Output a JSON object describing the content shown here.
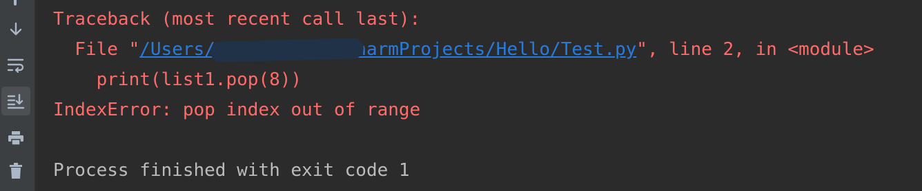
{
  "toolbar": {
    "buttons": [
      {
        "icon": "arrow-down-icon",
        "active": false
      },
      {
        "icon": "soft-wrap-icon",
        "active": false
      },
      {
        "icon": "scroll-to-end-icon",
        "active": true
      },
      {
        "icon": "print-icon",
        "active": false
      },
      {
        "icon": "trash-icon",
        "active": false
      }
    ]
  },
  "console": {
    "traceback_header": "Traceback (most recent call last):",
    "file_prefix": "  File \"",
    "file_path": "/Users/         /PycharmProjects/Hello/Test.py",
    "file_suffix": "\", line 2, in <module>",
    "code_line": "    print(list1.pop(8))",
    "error_line": "IndexError: pop index out of range",
    "exit_line": "Process finished with exit code 1"
  },
  "colors": {
    "background": "#2b2b2b",
    "toolbar": "#3c3f41",
    "error_text": "#ff6b68",
    "link": "#287bde",
    "normal_text": "#bbbbbb"
  }
}
